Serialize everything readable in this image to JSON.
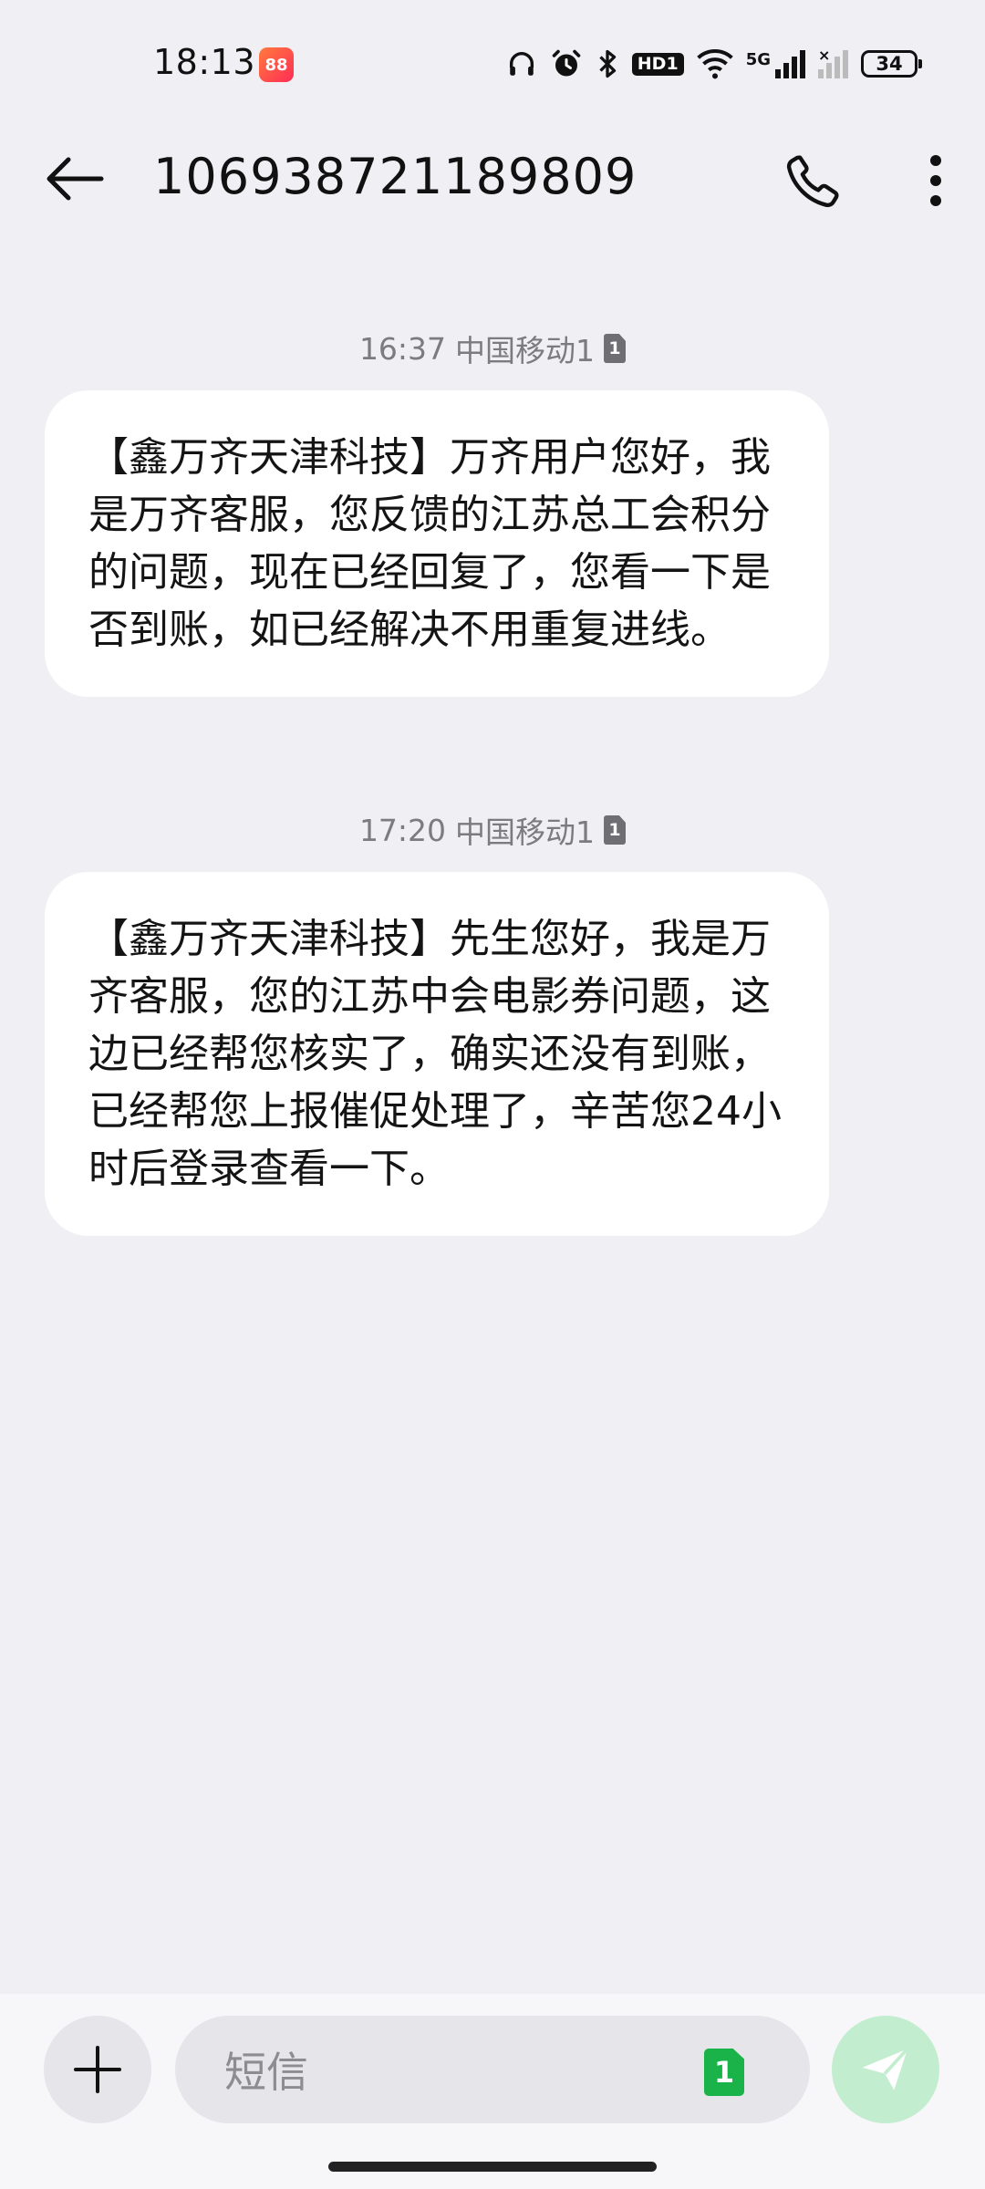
{
  "status_bar": {
    "time": "18:13",
    "app_badge": "88",
    "hd_label": "HD1",
    "network_label": "5G",
    "battery": "34"
  },
  "header": {
    "title": "106938721189809"
  },
  "messages": [
    {
      "time": "16:37",
      "carrier": "中国移动1",
      "sim": "1",
      "text": "【鑫万齐天津科技】万齐用户您好，我是万齐客服，您反馈的江苏总工会积分的问题，现在已经回复了，您看一下是否到账，如已经解决不用重复进线。"
    },
    {
      "time": "17:20",
      "carrier": "中国移动1",
      "sim": "1",
      "text": "【鑫万齐天津科技】先生您好，我是万齐客服，您的江苏中会电影券问题，这边已经帮您核实了，确实还没有到账，已经帮您上报催促处理了，辛苦您24小时后登录查看一下。"
    }
  ],
  "composer": {
    "placeholder": "短信",
    "sim": "1"
  },
  "colors": {
    "background": "#EFEFF4",
    "bubble": "#FFFFFF",
    "sim_green": "#19B34A",
    "send_disabled": "#C3EDCF"
  }
}
